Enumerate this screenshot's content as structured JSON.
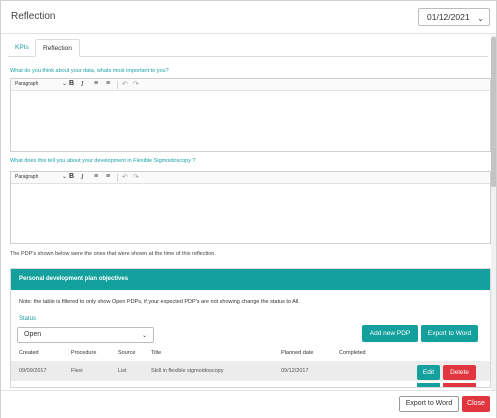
{
  "header": {
    "title": "Reflection",
    "date": "01/12/2021",
    "date_icon": "chevron-down-icon"
  },
  "tabs": [
    {
      "label": "KPIs"
    },
    {
      "label": "Reflection"
    }
  ],
  "questions": [
    {
      "label": "What do you think about your data, whats most important to you?",
      "value": ""
    },
    {
      "label": "What does this tell you about your development in Flexible Sigmoidoscopy ?",
      "value": ""
    }
  ],
  "toolbar": {
    "format": "Paragraph",
    "bold": "B",
    "italic": "I",
    "bullet_list_icon": "bulleted-list-icon",
    "numbered_list_icon": "numbered-list-icon",
    "undo_icon": "undo-icon",
    "redo_icon": "redo-icon"
  },
  "pdp_note": "The PDP's shown below were the ones that were shown at the time of this reflection.",
  "pdp_panel": {
    "title": "Personal development plan objectives",
    "filter_note": "Note: the table is filtered to only show Open PDPs, if your expected PDP's are not showing change the status to All.",
    "status_label": "Status",
    "status_value": "Open",
    "add_button": "Add new PDP",
    "export_button": "Export to Word",
    "columns": [
      "Created",
      "Procedure",
      "Source",
      "Title",
      "Planned date",
      "Completed"
    ],
    "rows": [
      {
        "created": "09/09/2017",
        "procedure": "Flexi",
        "source": "List",
        "title": "Skill in flexible sigmoidoscopy",
        "planned": "09/12/2017",
        "completed": "",
        "edit": "Edit",
        "delete": "Delete"
      }
    ]
  },
  "footer": {
    "export_button": "Export to Word",
    "close_button": "Close"
  },
  "colors": {
    "accent": "#14a09c",
    "danger": "#e2363f",
    "link": "#1aa0a8"
  }
}
